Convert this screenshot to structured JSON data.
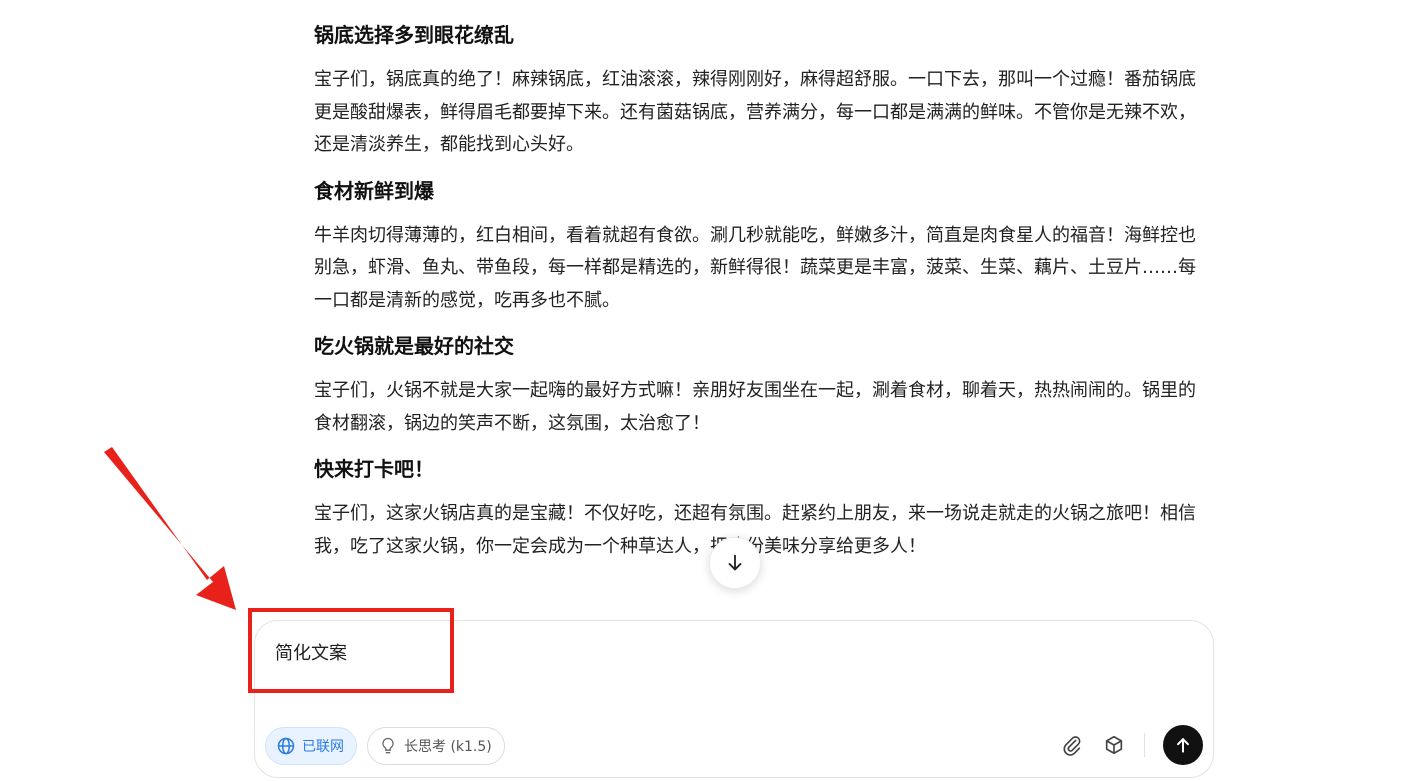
{
  "article": {
    "sections": [
      {
        "title": "锅底选择多到眼花缭乱",
        "body": "宝子们，锅底真的绝了！麻辣锅底，红油滚滚，辣得刚刚好，麻得超舒服。一口下去，那叫一个过瘾！番茄锅底更是酸甜爆表，鲜得眉毛都要掉下来。还有菌菇锅底，营养满分，每一口都是满满的鲜味。不管你是无辣不欢，还是清淡养生，都能找到心头好。"
      },
      {
        "title": "食材新鲜到爆",
        "body": "牛羊肉切得薄薄的，红白相间，看着就超有食欲。涮几秒就能吃，鲜嫩多汁，简直是肉食星人的福音！海鲜控也别急，虾滑、鱼丸、带鱼段，每一样都是精选的，新鲜得很！蔬菜更是丰富，菠菜、生菜、藕片、土豆片……每一口都是清新的感觉，吃再多也不腻。"
      },
      {
        "title": "吃火锅就是最好的社交",
        "body": "宝子们，火锅不就是大家一起嗨的最好方式嘛！亲朋好友围坐在一起，涮着食材，聊着天，热热闹闹的。锅里的食材翻滚，锅边的笑声不断，这氛围，太治愈了！"
      },
      {
        "title": "快来打卡吧！",
        "body": "宝子们，这家火锅店真的是宝藏！不仅好吃，还超有氛围。赶紧约上朋友，来一场说走就走的火锅之旅吧！相信我，吃了这家火锅，你一定会成为一个种草达人，把这份美味分享给更多人！"
      }
    ]
  },
  "composer": {
    "input_text": "简化文案",
    "web_chip_label": "已联网",
    "think_chip_label": "长思考 (k1.5)"
  },
  "icons": {
    "scroll_down": "arrow-down-icon",
    "web": "globe-icon",
    "think": "lightbulb-icon",
    "attach": "paperclip-icon",
    "cube": "cube-icon",
    "send": "arrow-up-icon"
  },
  "colors": {
    "annotation_red": "#e8221b",
    "web_chip_blue": "#2b7be0",
    "send_button": "#111111"
  }
}
